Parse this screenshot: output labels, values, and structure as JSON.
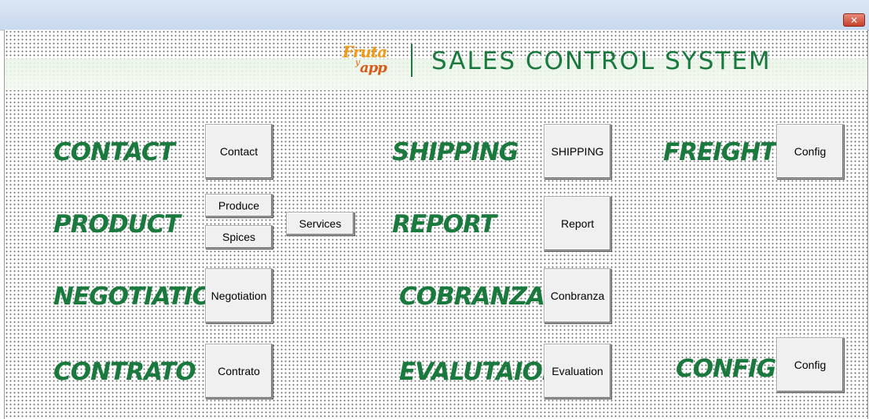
{
  "window": {
    "close_glyph": "✕"
  },
  "header": {
    "logo_text_1": "Fruta",
    "logo_text_2": "y",
    "logo_text_3": "app",
    "title": "SALES CONTROL SYSTEM"
  },
  "labels": {
    "contact": "CONTACT",
    "product": "PRODUCT",
    "negotiation": "NEGOTIATION",
    "contrato": "CONTRATO",
    "shipping": "SHIPPING",
    "report": "REPORT",
    "cobranza": "COBRANZA",
    "evaluation": "EVALUTAION",
    "freight": "FREIGHT",
    "config": "CONFIG"
  },
  "buttons": {
    "contact": "Contact",
    "produce": "Produce",
    "spices": "Spices",
    "services": "Services",
    "negotiation": "Negotiation",
    "contrato": "Contrato",
    "shipping": "SHIPPING",
    "report": "Report",
    "cobranza": "Conbranza",
    "evaluation": "Evaluation",
    "freight_config": "Config",
    "config": "Config"
  },
  "colors": {
    "accent_green": "#1a7a3e",
    "logo_orange": "#f39a16",
    "close_red": "#c7412b"
  }
}
